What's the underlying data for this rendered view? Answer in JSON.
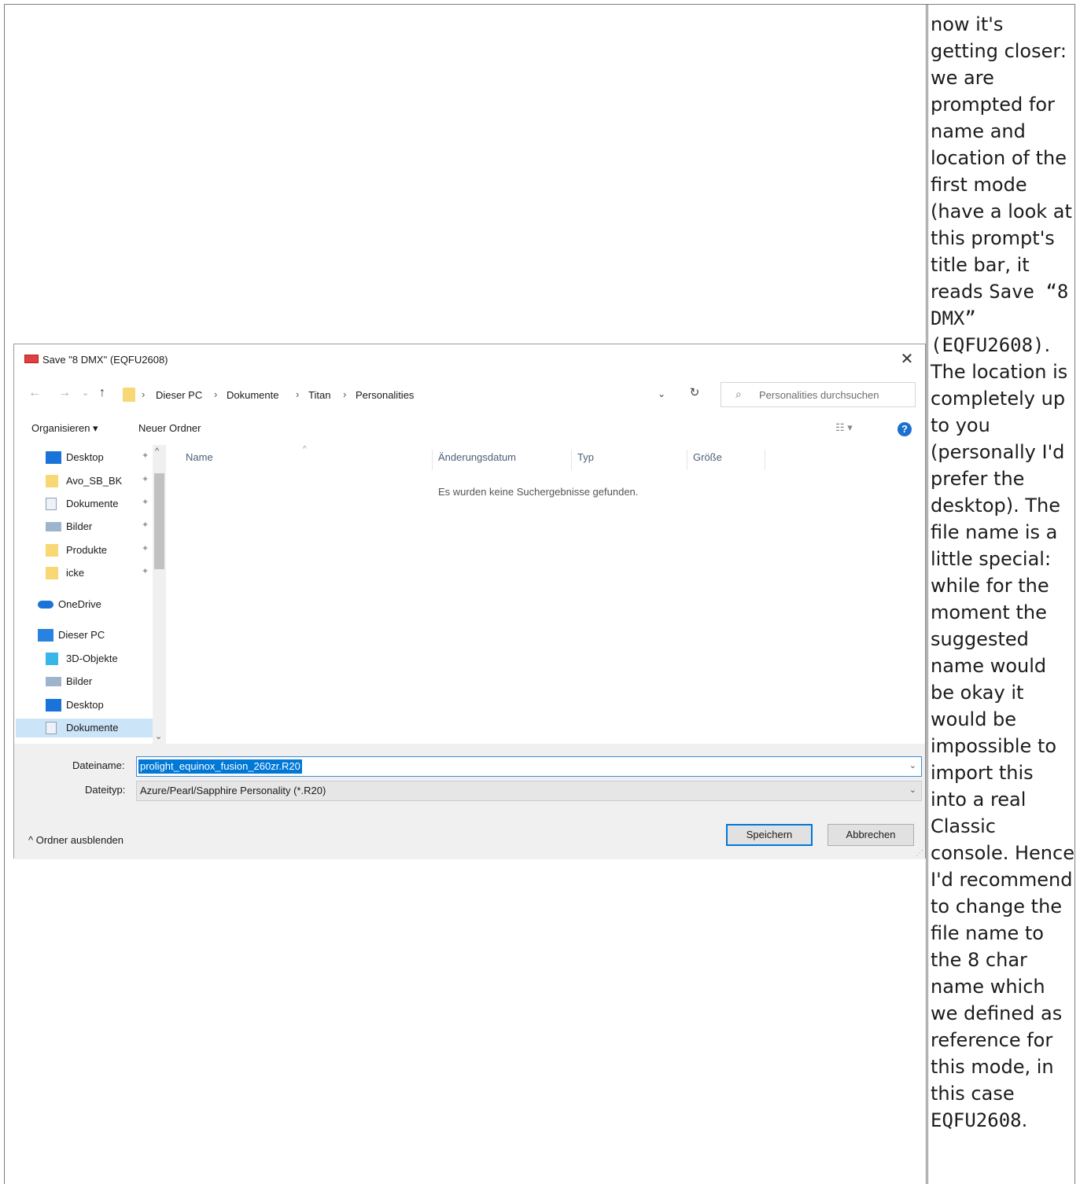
{
  "note": {
    "part1": "now it's getting closer: we are prompted for name and location of the first mode (have a look at this prompt's title bar, it reads",
    "code1": "Save “8 DMX” (EQFU2608)",
    "part2": ". The location is completely up to you (personally I'd prefer the desktop). The file name is a little special: while for the moment the suggested name would be okay it would be impossible to import this into a real Classic console. Hence I'd recommend to change the file name to the 8 char name which we defined as reference for this mode, in this case",
    "code2": "EQFU2608",
    "part3": "."
  },
  "dialog": {
    "title": "Save \"8 DMX\" (EQFU2608)",
    "close": "✕",
    "nav": {
      "back": "←",
      "forward": "→",
      "recent": "⌄",
      "up": "↑"
    },
    "breadcrumb": [
      "Dieser PC",
      "Dokumente",
      "Titan",
      "Personalities"
    ],
    "breadcrumb_sep": "›",
    "address_dropdown": "⌄",
    "refresh": "↻",
    "search_placeholder": "Personalities durchsuchen",
    "toolbar": {
      "organize": "Organisieren ▾",
      "new_folder": "Neuer Ordner",
      "view": "☷ ▾",
      "help": "?"
    },
    "sidebar": [
      {
        "label": "Desktop",
        "icon": "desktop-icon",
        "pinned": true
      },
      {
        "label": "Avo_SB_BK",
        "icon": "folder-icon",
        "pinned": true
      },
      {
        "label": "Dokumente",
        "icon": "documents-icon",
        "pinned": true
      },
      {
        "label": "Bilder",
        "icon": "pictures-icon",
        "pinned": true
      },
      {
        "label": "Produkte",
        "icon": "folder-icon",
        "pinned": true
      },
      {
        "label": "icke",
        "icon": "folder-icon",
        "pinned": true
      },
      {
        "label": "OneDrive",
        "icon": "cloud-icon",
        "pinned": false
      },
      {
        "label": "Dieser PC",
        "icon": "computer-icon",
        "pinned": false
      },
      {
        "label": "3D-Objekte",
        "icon": "cube-icon",
        "pinned": false
      },
      {
        "label": "Bilder",
        "icon": "pictures-icon",
        "pinned": false
      },
      {
        "label": "Desktop",
        "icon": "desktop-icon",
        "pinned": false
      },
      {
        "label": "Dokumente",
        "icon": "documents-icon",
        "pinned": false,
        "selected": true
      }
    ],
    "pin_glyph": "📌",
    "columns": [
      "Name",
      "Änderungsdatum",
      "Typ",
      "Größe"
    ],
    "empty_message": "Es wurden keine Suchergebnisse gefunden.",
    "filename_label": "Dateiname:",
    "filename_value": "prolight_equinox_fusion_260zr.R20",
    "filetype_label": "Dateityp:",
    "filetype_value": "Azure/Pearl/Sapphire Personality (*.R20)",
    "hide_folders": "^  Ordner ausblenden",
    "save_button": "Speichern",
    "cancel_button": "Abbrechen"
  },
  "colors": {
    "accent": "#0078d7",
    "selected_bg": "#cce4f7",
    "folder": "#f8d775"
  }
}
